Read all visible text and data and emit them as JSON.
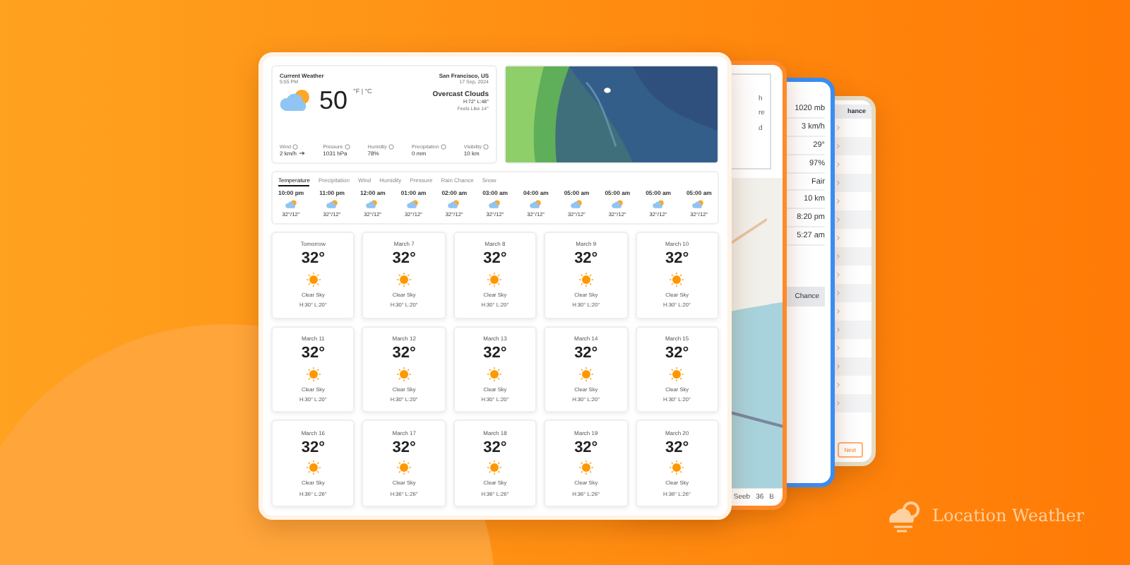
{
  "current": {
    "title": "Current Weather",
    "time": "5:55 PM",
    "location": "San Francisco, US",
    "date": "17 Sep, 2024",
    "temperature": "50",
    "units": "°F | °C",
    "condition": "Overcast Clouds",
    "high_low": "H:72° L:48°",
    "feels_like": "Feels Like 14°",
    "stats": [
      {
        "label": "Wind",
        "value": "2 km/h"
      },
      {
        "label": "Pressure",
        "value": "1031 hPa"
      },
      {
        "label": "Humidity",
        "value": "78%"
      },
      {
        "label": "Precipitation",
        "value": "0 mm"
      },
      {
        "label": "Visibility",
        "value": "10 km"
      }
    ]
  },
  "hourly": {
    "tabs": [
      {
        "label": "Temperature",
        "selected": true
      },
      {
        "label": "Precipitation",
        "selected": false
      },
      {
        "label": "Wind",
        "selected": false
      },
      {
        "label": "Humidity",
        "selected": false
      },
      {
        "label": "Pressure",
        "selected": false
      },
      {
        "label": "Rain Chance",
        "selected": false
      },
      {
        "label": "Snow",
        "selected": false
      }
    ],
    "hours": [
      {
        "time": "10:00 pm",
        "temps": "32°/12°"
      },
      {
        "time": "11:00 pm",
        "temps": "32°/12°"
      },
      {
        "time": "12:00 am",
        "temps": "32°/12°"
      },
      {
        "time": "01:00 am",
        "temps": "32°/12°"
      },
      {
        "time": "02:00 am",
        "temps": "32°/12°"
      },
      {
        "time": "03:00 am",
        "temps": "32°/12°"
      },
      {
        "time": "04:00 am",
        "temps": "32°/12°"
      },
      {
        "time": "05:00 am",
        "temps": "32°/12°"
      },
      {
        "time": "05:00 am",
        "temps": "32°/12°"
      },
      {
        "time": "05:00 am",
        "temps": "32°/12°"
      },
      {
        "time": "05:00 am",
        "temps": "32°/12°"
      }
    ]
  },
  "forecast": [
    {
      "day": "Tomorrow",
      "temperature": "32°",
      "condition": "Clear Sky",
      "high_low": "H:30° L:20°"
    },
    {
      "day": "March 7",
      "temperature": "32°",
      "condition": "Clear Sky",
      "high_low": "H:30° L:20°"
    },
    {
      "day": "March 8",
      "temperature": "32°",
      "condition": "Clear Sky",
      "high_low": "H:30° L:20°"
    },
    {
      "day": "March 9",
      "temperature": "32°",
      "condition": "Clear Sky",
      "high_low": "H:30° L:20°"
    },
    {
      "day": "March 10",
      "temperature": "32°",
      "condition": "Clear Sky",
      "high_low": "H:30° L:20°"
    },
    {
      "day": "March 11",
      "temperature": "32°",
      "condition": "Clear Sky",
      "high_low": "H:30° L:20°"
    },
    {
      "day": "March 12",
      "temperature": "32°",
      "condition": "Clear Sky",
      "high_low": "H:30° L:20°"
    },
    {
      "day": "March 13",
      "temperature": "32°",
      "condition": "Clear Sky",
      "high_low": "H:30° L:20°"
    },
    {
      "day": "March 14",
      "temperature": "32°",
      "condition": "Clear Sky",
      "high_low": "H:30° L:20°"
    },
    {
      "day": "March 15",
      "temperature": "32°",
      "condition": "Clear Sky",
      "high_low": "H:30° L:20°"
    },
    {
      "day": "March 16",
      "temperature": "32°",
      "condition": "Clear Sky",
      "high_low": "H:36° L:26°"
    },
    {
      "day": "March 17",
      "temperature": "32°",
      "condition": "Clear Sky",
      "high_low": "H:36° L:26°"
    },
    {
      "day": "March 18",
      "temperature": "32°",
      "condition": "Clear Sky",
      "high_low": "H:36° L:26°"
    },
    {
      "day": "March 19",
      "temperature": "32°",
      "condition": "Clear Sky",
      "high_low": "H:36° L:26°"
    },
    {
      "day": "March 20",
      "temperature": "32°",
      "condition": "Clear Sky",
      "high_low": "H:36° L:26°"
    }
  ],
  "map_card": {
    "fragments": [
      "h",
      "re",
      "d"
    ],
    "footer_place": "Seeb",
    "footer_value": "36",
    "footer_place_2": "B"
  },
  "details_card": {
    "values": [
      "1020 mb",
      "3 km/h",
      "29°",
      "97%",
      "Fair",
      "10 km",
      "8:20 pm",
      "5:27 am"
    ],
    "header": "Chance"
  },
  "table_card": {
    "header": "hance",
    "button": "Next"
  },
  "brand": "Location Weather"
}
